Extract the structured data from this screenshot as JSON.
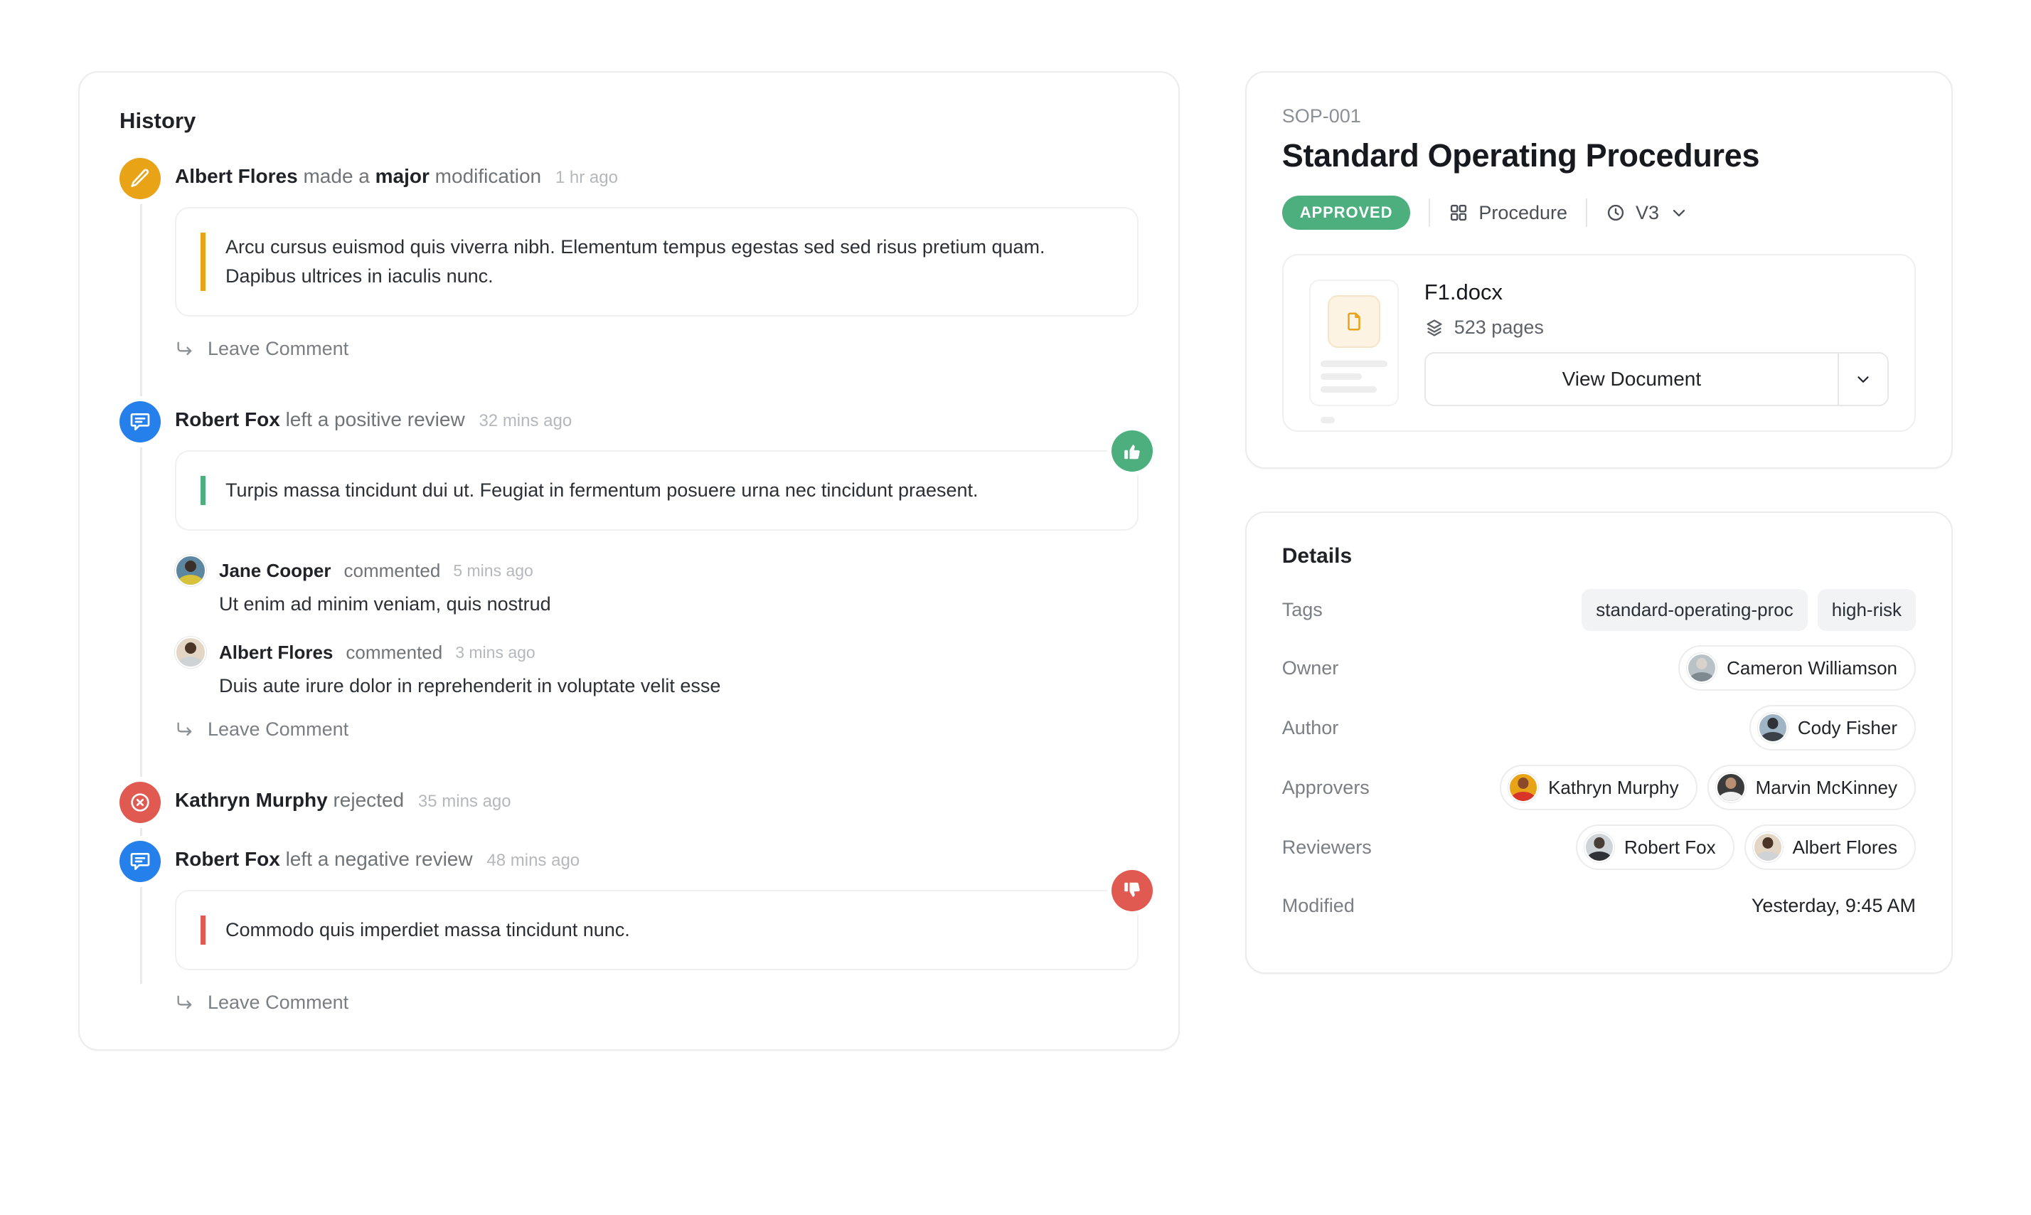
{
  "history": {
    "title": "History",
    "leave_comment_label": "Leave Comment",
    "entries": [
      {
        "icon": "edit-icon",
        "actor": "Albert Flores",
        "action_pre": "made a ",
        "action_strong": "major",
        "action_post": " modification",
        "time": "1 hr ago",
        "quote": "Arcu cursus euismod quis viverra nibh. Elementum tempus egestas sed sed risus pretium quam. Dapibus ultrices in iaculis nunc."
      },
      {
        "icon": "review-icon",
        "actor": "Robert Fox",
        "action": "left a positive review",
        "time": "32 mins ago",
        "verdict": "thumbs-up",
        "quote": "Turpis massa tincidunt dui ut. Feugiat in fermentum posuere urna nec tincidunt praesent.",
        "comments": [
          {
            "actor": "Jane Cooper",
            "action": "commented",
            "time": "5 mins ago",
            "text": "Ut enim ad minim veniam, quis nostrud"
          },
          {
            "actor": "Albert Flores",
            "action": "commented",
            "time": "3 mins ago",
            "text": "Duis aute irure dolor in reprehenderit in voluptate velit esse"
          }
        ]
      },
      {
        "icon": "reject-icon",
        "actor": "Kathryn Murphy",
        "action": "rejected",
        "time": "35 mins ago"
      },
      {
        "icon": "review-icon",
        "actor": "Robert Fox",
        "action": "left a negative review",
        "time": "48 mins ago",
        "verdict": "thumbs-down",
        "quote": "Commodo quis imperdiet massa tincidunt nunc."
      }
    ]
  },
  "document": {
    "sop_id": "SOP-001",
    "title": "Standard Operating Procedures",
    "status": "APPROVED",
    "type": "Procedure",
    "version": "V3",
    "file_name": "F1.docx",
    "pages": "523 pages",
    "view_button": "View Document"
  },
  "details": {
    "title": "Details",
    "labels": {
      "tags": "Tags",
      "owner": "Owner",
      "author": "Author",
      "approvers": "Approvers",
      "reviewers": "Reviewers",
      "modified": "Modified"
    },
    "tags": [
      "standard-operating-proc",
      "high-risk"
    ],
    "owner": "Cameron Williamson",
    "author": "Cody Fisher",
    "approvers": [
      "Kathryn Murphy",
      "Marvin McKinney"
    ],
    "reviewers": [
      "Robert Fox",
      "Albert Flores"
    ],
    "modified": "Yesterday, 9:45 AM"
  },
  "colors": {
    "approved_green": "#4CAF7D",
    "edit_orange": "#E8A317",
    "review_blue": "#2680EB",
    "reject_red": "#E05A52"
  }
}
